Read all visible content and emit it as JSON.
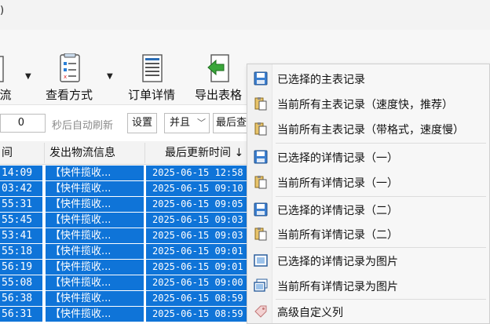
{
  "top": {
    "fragment": ")"
  },
  "toolbar": {
    "items": [
      {
        "label": "流",
        "icon": "flow-icon"
      },
      {
        "label": "查看方式",
        "icon": "view-mode-icon"
      },
      {
        "label": "订单详情",
        "icon": "order-details-icon"
      },
      {
        "label": "导出表格",
        "icon": "export-table-icon"
      }
    ]
  },
  "filter": {
    "seconds_value": "0",
    "auto_refresh_label": "秒后自动刷新",
    "settings_label": "设置",
    "logic_value": "并且",
    "last_query_label": "最后查"
  },
  "table": {
    "columns": [
      "间",
      "发出物流信息",
      "最后更新时间 ↓"
    ],
    "rows": [
      {
        "time": "14:09",
        "info": "【快件揽收...",
        "updated": "2025-06-15 12:58"
      },
      {
        "time": "03:42",
        "info": "【快件揽收...",
        "updated": "2025-06-15 09:10"
      },
      {
        "time": "55:31",
        "info": "【快件揽收...",
        "updated": "2025-06-15 09:05"
      },
      {
        "time": "55:45",
        "info": "【快件揽收...",
        "updated": "2025-06-15 09:03"
      },
      {
        "time": "53:41",
        "info": "【快件揽收...",
        "updated": "2025-06-15 09:03"
      },
      {
        "time": "55:18",
        "info": "【快件揽收...",
        "updated": "2025-06-15 09:01"
      },
      {
        "time": "56:19",
        "info": "【快件揽收...",
        "updated": "2025-06-15 09:01"
      },
      {
        "time": "55:08",
        "info": "【快件揽收...",
        "updated": "2025-06-15 09:00"
      },
      {
        "time": "56:38",
        "info": "【快件揽收...",
        "updated": "2025-06-15 08:59"
      },
      {
        "time": "56:31",
        "info": "【快件揽收...",
        "updated": "2025-06-15 08:59"
      }
    ]
  },
  "menu": {
    "items": [
      {
        "label": "已选择的主表记录",
        "icon": "save-disk-icon"
      },
      {
        "label": "当前所有主表记录（速度快，推荐）",
        "icon": "clipboard-icon"
      },
      {
        "label": "当前所有主表记录（带格式，速度慢）",
        "icon": "clipboard-icon"
      },
      {
        "label": "已选择的详情记录（一）",
        "icon": "save-disk-icon"
      },
      {
        "label": "当前所有详情记录（一）",
        "icon": "clipboard-icon"
      },
      {
        "label": "已选择的详情记录（二）",
        "icon": "save-disk-icon"
      },
      {
        "label": "当前所有详情记录（二）",
        "icon": "clipboard-icon"
      },
      {
        "label": "已选择的详情记录为图片",
        "icon": "image-frame-icon"
      },
      {
        "label": "当前所有详情记录为图片",
        "icon": "image-stack-icon"
      },
      {
        "label": "高级自定义列",
        "icon": "tag-icon"
      }
    ]
  },
  "colors": {
    "selection": "#0f74d8",
    "menu_bg": "#f7f7f7"
  }
}
